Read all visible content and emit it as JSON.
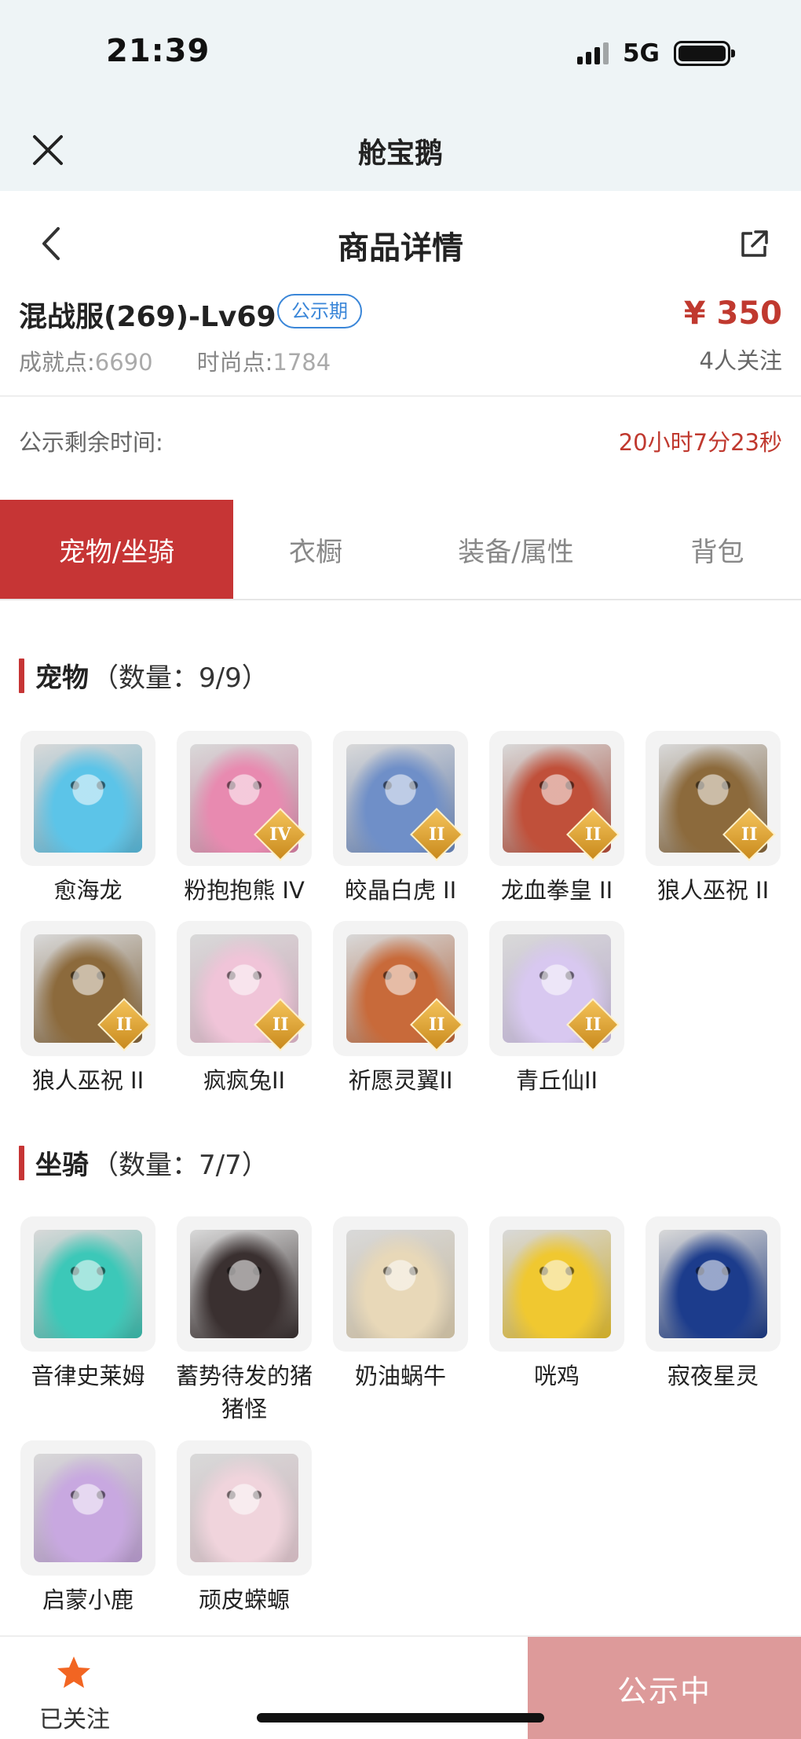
{
  "status_bar": {
    "time": "21:39",
    "network": "5G"
  },
  "app_bar": {
    "title": "舱宝鹅"
  },
  "page_header": {
    "title": "商品详情"
  },
  "product": {
    "name": "混战服(269)-Lv69",
    "status_tag": "公示期",
    "price": "¥ 350",
    "achievement_label": "成就点:",
    "achievement_value": "6690",
    "fashion_label": "时尚点:",
    "fashion_value": "1784",
    "followers": "4人关注"
  },
  "publicity": {
    "label": "公示剩余时间:",
    "value": "20小时7分23秒"
  },
  "tabs": [
    {
      "label": "宠物/坐骑",
      "active": true
    },
    {
      "label": "衣橱",
      "active": false
    },
    {
      "label": "装备/属性",
      "active": false
    },
    {
      "label": "背包",
      "active": false
    }
  ],
  "pets": {
    "title": "宠物",
    "count": "（数量：9/9）",
    "items": [
      {
        "name": "愈海龙",
        "rank": "",
        "color": "#5cc4e8"
      },
      {
        "name": "粉抱抱熊 IV",
        "rank": "IV",
        "color": "#e88ab0"
      },
      {
        "name": "皎晶白虎 II",
        "rank": "II",
        "color": "#6f8fc8"
      },
      {
        "name": "龙血拳皇 II",
        "rank": "II",
        "color": "#c0503a"
      },
      {
        "name": "狼人巫祝 II",
        "rank": "II",
        "color": "#8c6a3c"
      },
      {
        "name": "狼人巫祝 II",
        "rank": "II",
        "color": "#8c6a3c"
      },
      {
        "name": "疯疯兔II",
        "rank": "II",
        "color": "#f0c4d8"
      },
      {
        "name": "祈愿灵翼II",
        "rank": "II",
        "color": "#c86a3a"
      },
      {
        "name": "青丘仙II",
        "rank": "II",
        "color": "#d8c8f0"
      }
    ]
  },
  "mounts": {
    "title": "坐骑",
    "count": "（数量：7/7）",
    "items": [
      {
        "name": "音律史莱姆",
        "color": "#3cc8b8"
      },
      {
        "name": "蓄势待发的猪猪怪",
        "color": "#3a3030"
      },
      {
        "name": "奶油蜗牛",
        "color": "#e8d8b8"
      },
      {
        "name": "咣鸡",
        "color": "#f0c830"
      },
      {
        "name": "寂夜星灵",
        "color": "#1c3c8c"
      },
      {
        "name": "启蒙小鹿",
        "color": "#c8a8e0"
      },
      {
        "name": "顽皮蝾螈",
        "color": "#f0d4dc"
      }
    ]
  },
  "bottom_bar": {
    "follow_label": "已关注",
    "cta_label": "公示中"
  },
  "colors": {
    "accent": "#c63535",
    "price": "#c0392f",
    "tag": "#3a86d8",
    "cta": "#dd9a9a"
  }
}
